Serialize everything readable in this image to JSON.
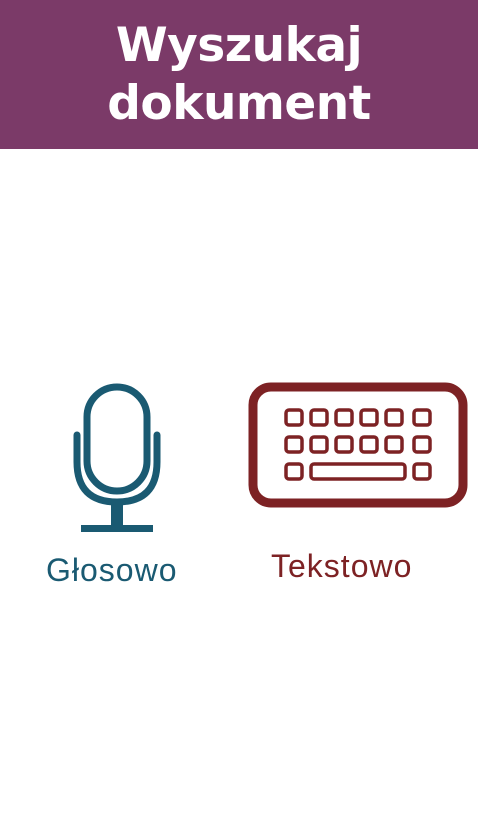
{
  "header": {
    "title": "Wyszukaj dokument",
    "background": "#7b3a68",
    "text_color": "#ffffff"
  },
  "options": {
    "voice": {
      "label": "Głosowo",
      "icon": "microphone-icon",
      "color": "#1a5a72"
    },
    "text": {
      "label": "Tekstowo",
      "icon": "keyboard-icon",
      "color": "#7d2224"
    }
  }
}
